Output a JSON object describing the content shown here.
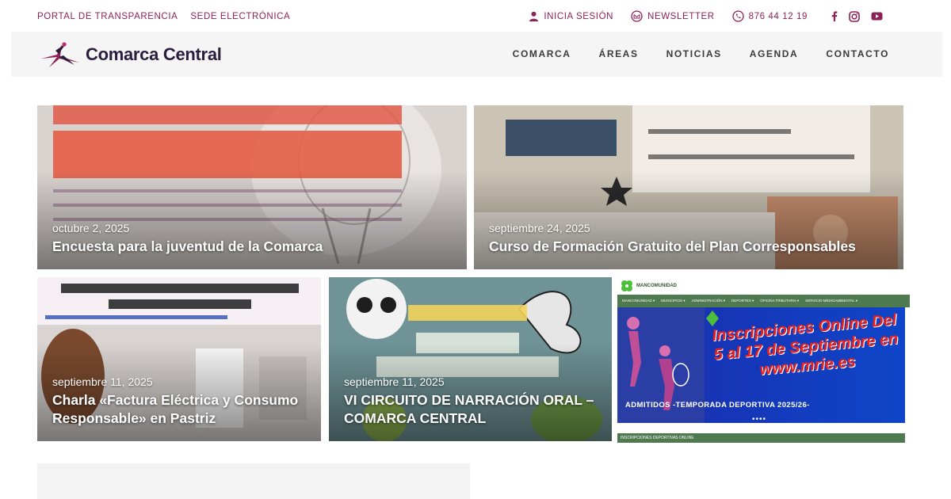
{
  "topbar": {
    "left_links": [
      "PORTAL DE TRANSPARENCIA",
      "SEDE ELECTRÓNICA"
    ],
    "login": "INICIA SESIÓN",
    "newsletter": "NEWSLETTER",
    "phone": "876 44 12 19",
    "social": [
      "facebook-icon",
      "instagram-icon",
      "youtube-icon"
    ]
  },
  "brand": {
    "name": "Comarca Central",
    "color": "#8e2157"
  },
  "nav": {
    "items": [
      "COMARCA",
      "ÁREAS",
      "NOTICIAS",
      "AGENDA",
      "CONTACTO"
    ]
  },
  "posts": [
    {
      "date": "octubre 2, 2025",
      "title": "Encuesta para la juventud de la Comarca"
    },
    {
      "date": "septiembre 24, 2025",
      "title": "Curso de Formación Gratuito del Plan Corresponsables"
    },
    {
      "date": "septiembre 11, 2025",
      "title": "Charla «Factura Eléctrica y Consumo Responsable» en Pastriz"
    },
    {
      "date": "septiembre 11, 2025",
      "title": "VI CIRCUITO DE NARRACIÓN ORAL – COMARCA CENTRAL"
    }
  ],
  "slider": {
    "org": "MANCOMUNIDAD",
    "menu": [
      "MANCOMUNIDAD ▾",
      "MUNICIPIOS ▾",
      "ADMINISTRACIÓN ▾",
      "DEPORTES ▾",
      "OFICINA TRIBUTARIA ▾",
      "SERVICIO MEDIOAMBIENTAL ▾"
    ],
    "promo": "Inscripciones Online Del 5 al 17 de Septiembre en www.mrie.es",
    "caption": "ADMITIDOS -TEMPORADA DEPORTIVA 2025/26-",
    "dots": "••••",
    "strip": "INSCRIPCIONES DEPORTIVAS ONLINE"
  }
}
